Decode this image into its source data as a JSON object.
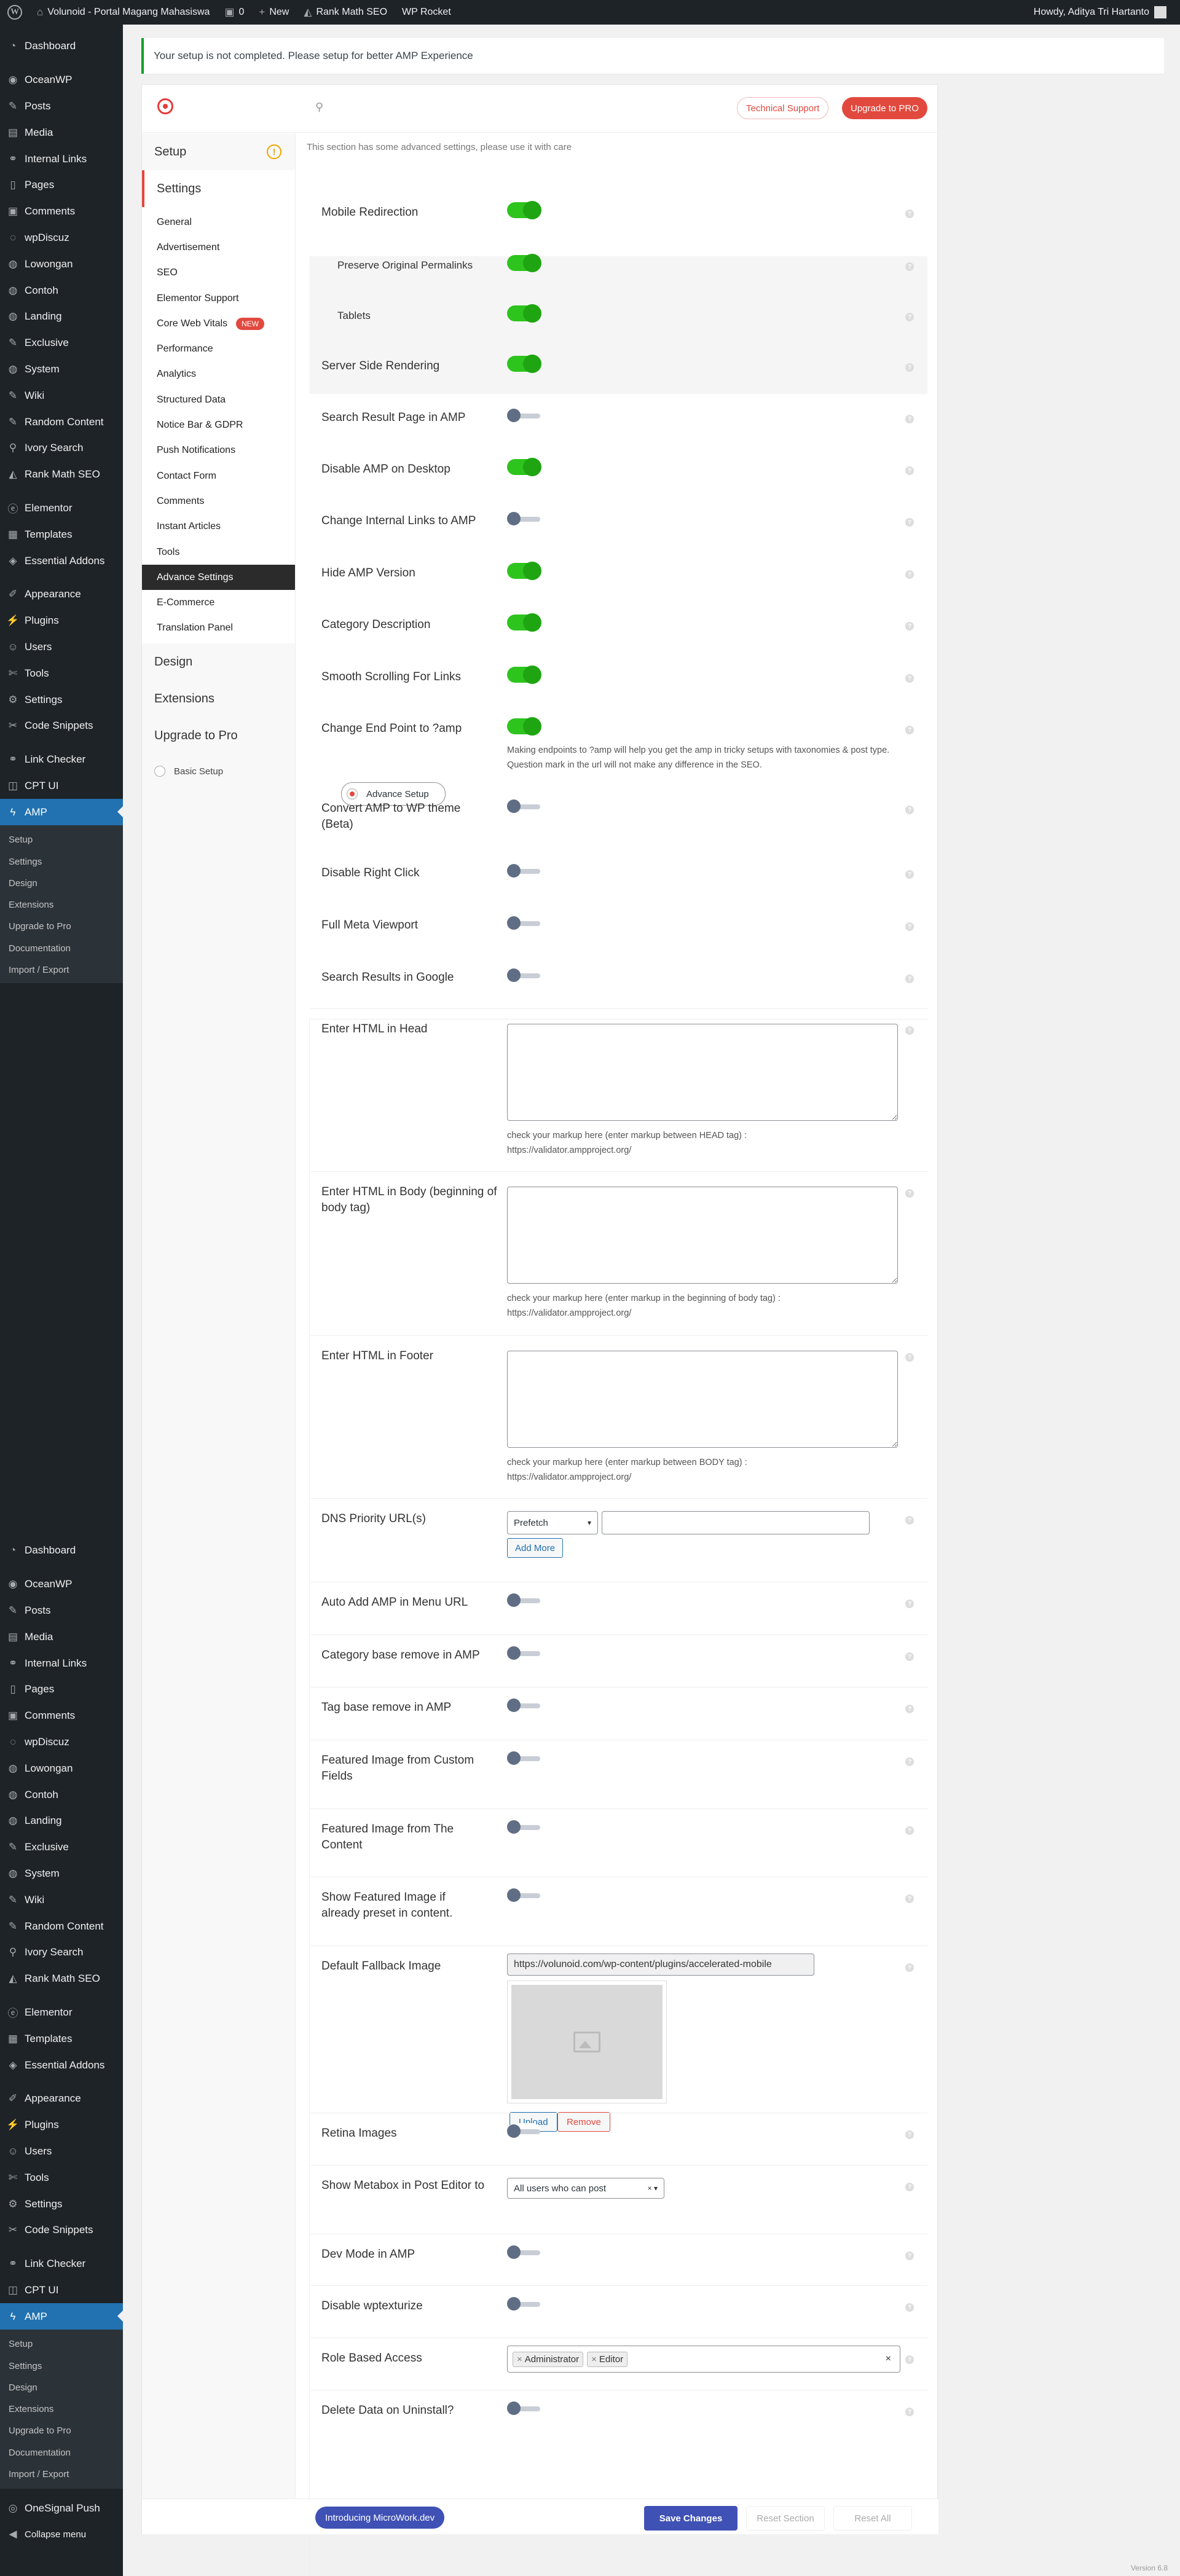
{
  "adminbar": {
    "site_name": "Volunoid - Portal Magang Mahasiswa",
    "comments_count": "0",
    "new_label": "New",
    "rankmath_label": "Rank Math SEO",
    "wprocket_label": "WP Rocket",
    "howdy": "Howdy, Aditya Tri Hartanto"
  },
  "sidebar": {
    "items": [
      {
        "label": "Dashboard",
        "icon": "dashboard-icon"
      },
      {
        "label": "OceanWP",
        "icon": "oceanwp-icon"
      },
      {
        "label": "Posts",
        "icon": "pin-icon"
      },
      {
        "label": "Media",
        "icon": "media-icon"
      },
      {
        "label": "Internal Links",
        "icon": "link-icon"
      },
      {
        "label": "Pages",
        "icon": "pages-icon"
      },
      {
        "label": "Comments",
        "icon": "comment-icon"
      },
      {
        "label": "wpDiscuz",
        "icon": "discuz-icon"
      },
      {
        "label": "Lowongan",
        "icon": "circle-icon"
      },
      {
        "label": "Contoh",
        "icon": "circle-icon"
      },
      {
        "label": "Landing",
        "icon": "circle-icon"
      },
      {
        "label": "Exclusive",
        "icon": "pin-icon"
      },
      {
        "label": "System",
        "icon": "circle-icon"
      },
      {
        "label": "Wiki",
        "icon": "pin-icon"
      },
      {
        "label": "Random Content",
        "icon": "pin-icon"
      },
      {
        "label": "Ivory Search",
        "icon": "search-icon"
      },
      {
        "label": "Rank Math SEO",
        "icon": "rankmath-icon"
      },
      {
        "label": "Elementor",
        "icon": "elementor-icon"
      },
      {
        "label": "Templates",
        "icon": "templates-icon"
      },
      {
        "label": "Essential Addons",
        "icon": "ea-icon"
      },
      {
        "label": "Appearance",
        "icon": "brush-icon"
      },
      {
        "label": "Plugins",
        "icon": "plugin-icon"
      },
      {
        "label": "Users",
        "icon": "users-icon"
      },
      {
        "label": "Tools",
        "icon": "tools-icon"
      },
      {
        "label": "Settings",
        "icon": "settings-icon"
      },
      {
        "label": "Code Snippets",
        "icon": "code-icon"
      },
      {
        "label": "Link Checker",
        "icon": "link-icon"
      },
      {
        "label": "CPT UI",
        "icon": "cpt-icon"
      },
      {
        "label": "AMP",
        "icon": "amp-icon"
      }
    ],
    "amp_sub": [
      "Setup",
      "Settings",
      "Design",
      "Extensions",
      "Upgrade to Pro",
      "Documentation",
      "Import / Export"
    ],
    "onesignal": "OneSignal Push",
    "collapse": "Collapse menu"
  },
  "notice": "Your setup is not completed. Please setup for better AMP Experience",
  "topbar": {
    "tech_support": "Technical Support",
    "upgrade": "Upgrade to PRO"
  },
  "nav": {
    "setup": "Setup",
    "settings": "Settings",
    "sub": [
      "General",
      "Advertisement",
      "SEO",
      "Elementor Support",
      "Core Web Vitals",
      "Performance",
      "Analytics",
      "Structured Data",
      "Notice Bar & GDPR",
      "Push Notifications",
      "Contact Form",
      "Comments",
      "Instant Articles",
      "Tools",
      "Advance Settings",
      "E-Commerce",
      "Translation Panel"
    ],
    "new_badge": "NEW",
    "design": "Design",
    "extensions": "Extensions",
    "upgrade": "Upgrade to Pro",
    "basic_setup": "Basic Setup",
    "advance_setup": "Advance Setup"
  },
  "content": {
    "intro": "This section has some advanced settings, please use it with care",
    "settings": [
      {
        "label": "Mobile Redirection",
        "on": true
      },
      {
        "label": "Preserve Original Permalinks",
        "on": true
      },
      {
        "label": "Tablets",
        "on": true
      },
      {
        "label": "Server Side Rendering",
        "on": true
      },
      {
        "label": "Search Result Page in AMP",
        "on": false
      },
      {
        "label": "Disable AMP on Desktop",
        "on": true
      },
      {
        "label": "Change Internal Links to AMP",
        "on": false
      },
      {
        "label": "Hide AMP Version",
        "on": true
      },
      {
        "label": "Category Description",
        "on": true
      },
      {
        "label": "Smooth Scrolling For Links",
        "on": true
      },
      {
        "label": "Change End Point to ?amp",
        "on": true
      },
      {
        "label": "Convert AMP to WP theme (Beta)",
        "on": false
      },
      {
        "label": "Disable Right Click",
        "on": false
      },
      {
        "label": "Full Meta Viewport",
        "on": false
      },
      {
        "label": "Search Results in Google",
        "on": false
      },
      {
        "label": "Enter HTML in Head"
      },
      {
        "label": "Enter HTML in Body (beginning of body tag)"
      },
      {
        "label": "Enter HTML in Footer"
      },
      {
        "label": "DNS Priority URL(s)"
      },
      {
        "label": "Auto Add AMP in Menu URL",
        "on": false
      },
      {
        "label": "Category base remove in AMP",
        "on": false
      },
      {
        "label": "Tag base remove in AMP",
        "on": false
      },
      {
        "label": "Featured Image from Custom Fields",
        "on": false
      },
      {
        "label": "Featured Image from The Content",
        "on": false
      },
      {
        "label": "Show Featured Image if already preset in content.",
        "on": false
      },
      {
        "label": "Default Fallback Image"
      },
      {
        "label": "Retina Images",
        "on": false
      },
      {
        "label": "Show Metabox in Post Editor to"
      },
      {
        "label": "Dev Mode in AMP",
        "on": false
      },
      {
        "label": "Disable wptexturize",
        "on": false
      },
      {
        "label": "Role Based Access"
      },
      {
        "label": "Delete Data on Uninstall?",
        "on": false
      }
    ],
    "endpoint_help": "Making endpoints to ?amp will help you get the amp in tricky setups with taxonomies & post type. Question mark in the url will not make any difference in the SEO.",
    "head_help": "check your markup here (enter markup between HEAD tag) : https://validator.ampproject.org/",
    "body_help": "check your markup here (enter markup in the beginning of body tag) : https://validator.ampproject.org/",
    "footer_help": "check your markup here (enter markup between BODY tag) : https://validator.ampproject.org/",
    "dns_select": "Prefetch",
    "add_more": "Add More",
    "fallback_url": "https://volunoid.com/wp-content/plugins/accelerated-mobile",
    "upload": "Upload",
    "remove": "Remove",
    "metabox_select": "All users who can post",
    "roles": [
      "Administrator",
      "Editor"
    ]
  },
  "footer": {
    "microwork": "Introducing MicroWork.dev",
    "save": "Save Changes",
    "reset_section": "Reset Section",
    "reset_all": "Reset All",
    "version": "Version 6.8"
  },
  "colors": {
    "accent": "#e2493e",
    "toggle_on": "#2ec41e",
    "wp_blue": "#2271b1",
    "save": "#3f51b5"
  }
}
